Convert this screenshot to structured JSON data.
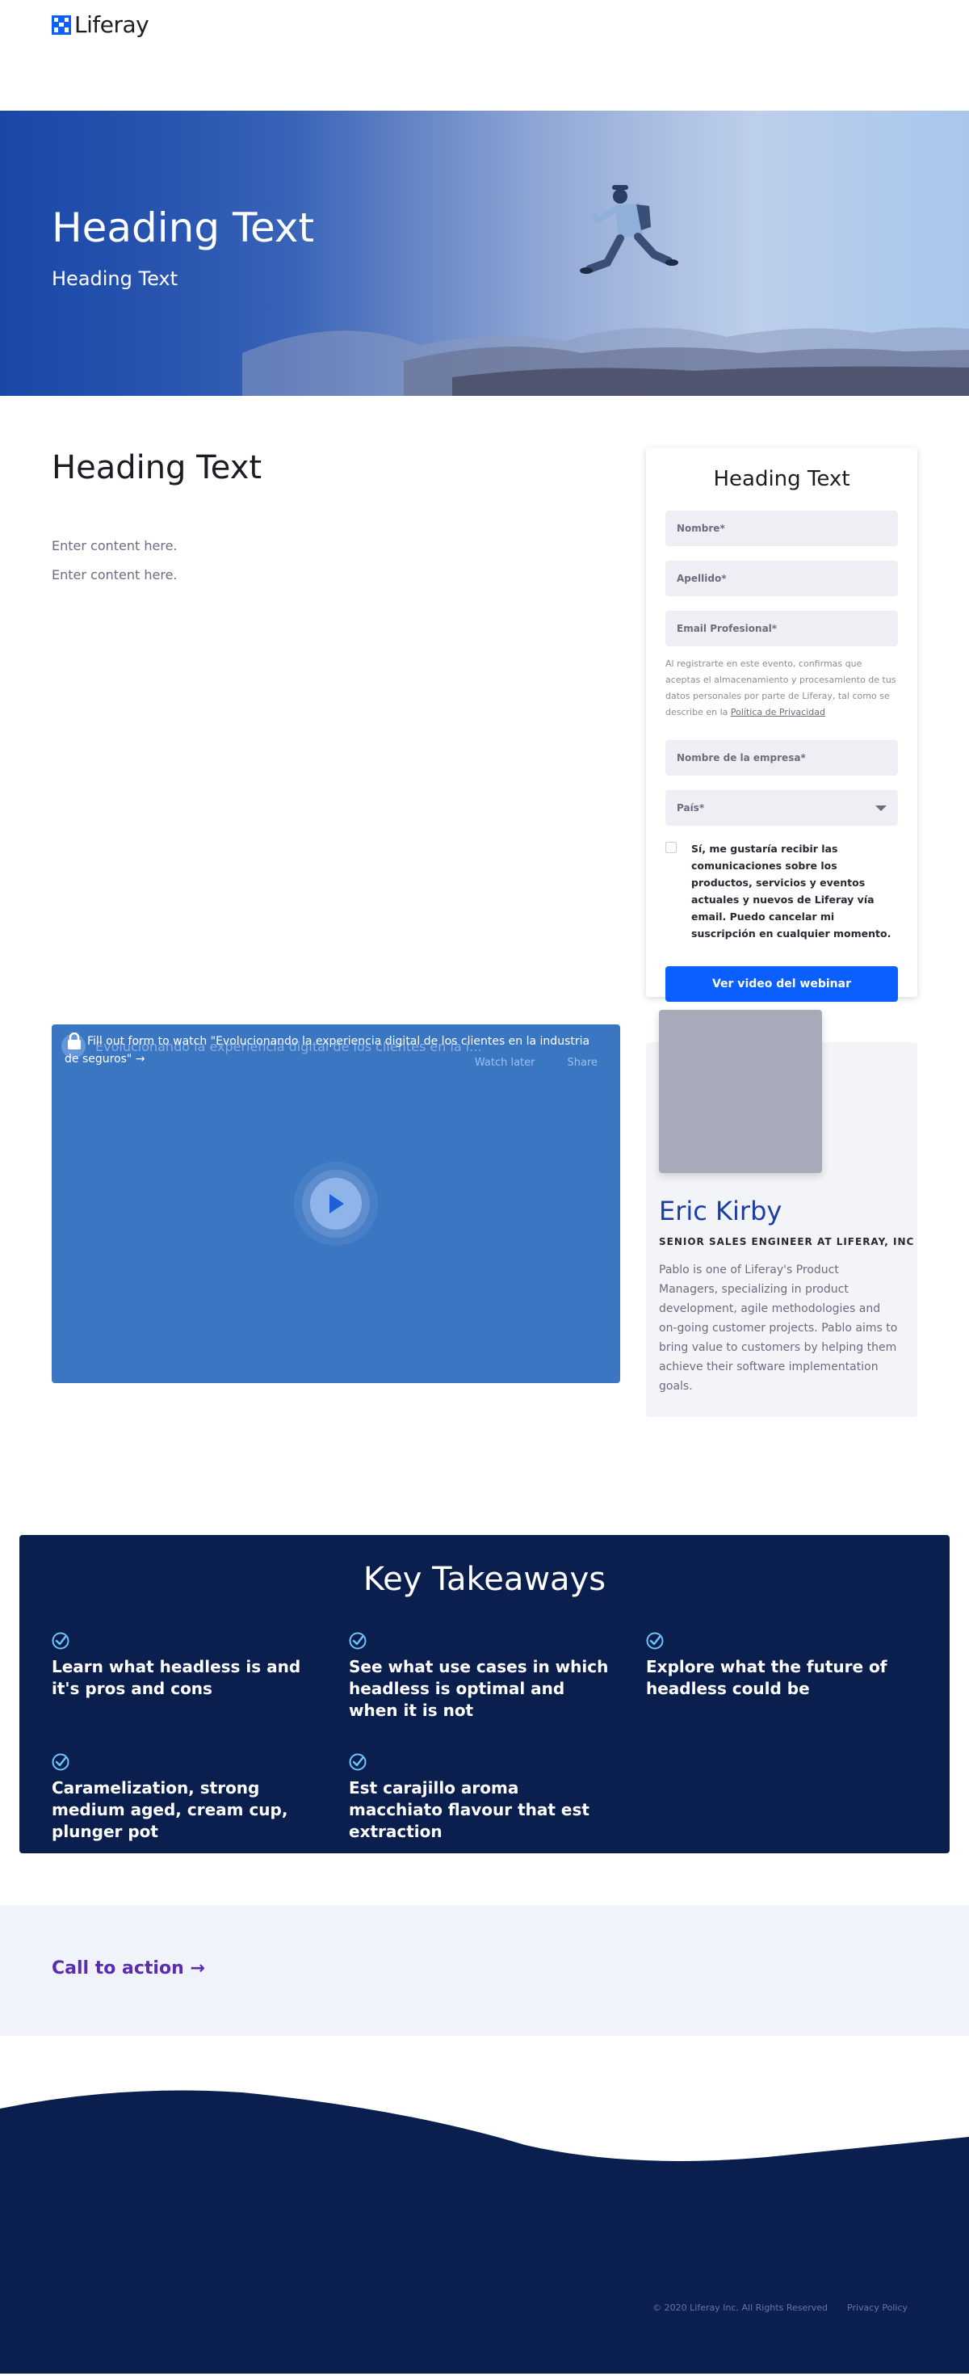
{
  "header": {
    "logo_text": "Liferay"
  },
  "hero": {
    "title": "Heading Text",
    "subtitle": "Heading Text"
  },
  "content": {
    "title": "Heading Text",
    "paragraphs": [
      "Enter content here.",
      "Enter content here."
    ]
  },
  "form": {
    "title": "Heading Text",
    "first_name": "Nombre*",
    "last_name": "Apellido*",
    "email": "Email Profesional*",
    "disclaimer": "Al registrarte en este evento, confirmas que aceptas el almacenamiento y procesamiento de tus datos personales por parte de Liferay, tal como se describe en la",
    "privacy_link": "Política de Privacidad",
    "company": "Nombre de la empresa*",
    "country": "País*",
    "consent": "Sí, me gustaría recibir las comunicaciones sobre los productos, servicios y eventos actuales y nuevos de Liferay vía email. Puedo cancelar mi suscripción en cualquier momento.",
    "submit": "Ver video del webinar"
  },
  "video": {
    "overlay": "Fill out form to watch \"Evolucionando la experiencia digital de los clientes en la industria de seguros\" →",
    "ghost_title": "Evolucionando la experiencia digital de los clientes en la i...",
    "watch_later": "Watch later",
    "share": "Share"
  },
  "speaker": {
    "name": "Eric Kirby",
    "role": "SENIOR SALES ENGINEER AT LIFERAY, INC",
    "bio": "Pablo is one of Liferay's Product Managers, specializing in product development, agile methodologies and on-going customer projects. Pablo aims to bring value to customers by helping them achieve their software implementation goals."
  },
  "takeaways": {
    "title": "Key Takeaways",
    "items": [
      "Learn what headless is and it's pros and cons",
      "See what use cases in which headless is optimal and when it is not",
      "Explore what the future of headless could be",
      "Caramelization, strong medium aged, cream cup, plunger pot",
      "Est carajillo aroma macchiato flavour that est extraction"
    ]
  },
  "cta": {
    "label": "Call to action →"
  },
  "footer": {
    "copyright": "© 2020 Liferay Inc. All Rights Reserved",
    "privacy": "Privacy Policy"
  },
  "colors": {
    "brand": "#0b5fff",
    "navy": "#0b1f4f",
    "speaker_name": "#1a3ea4",
    "cta": "#5b2bb0",
    "check": "#6fc3ff"
  },
  "icons": [
    "logo-icon",
    "lock-icon",
    "play-icon",
    "check-circle-icon",
    "chevron-down-icon"
  ]
}
